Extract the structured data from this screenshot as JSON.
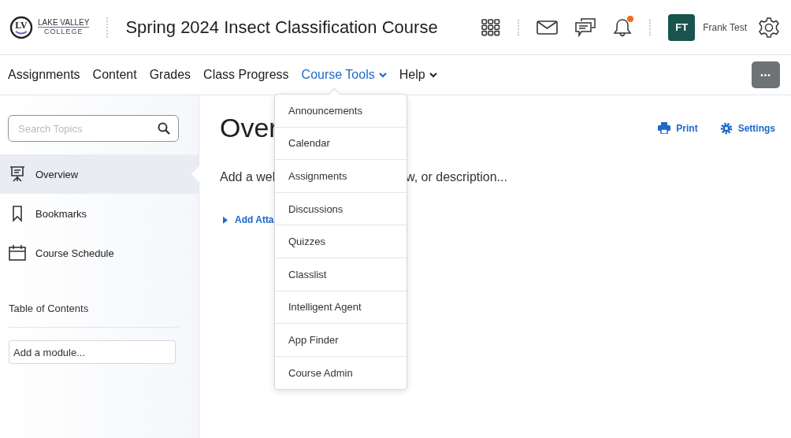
{
  "header": {
    "logo": {
      "line1": "LAKE VALLEY",
      "line2": "COLLEGE",
      "initials": "LV"
    },
    "course_title": "Spring 2024 Insect Classification Course",
    "notifications_unread": true,
    "user": {
      "initials": "FT",
      "name": "Frank Test"
    }
  },
  "nav": {
    "items": [
      {
        "label": "Assignments",
        "menu": false,
        "expanded": false
      },
      {
        "label": "Content",
        "menu": false,
        "expanded": false
      },
      {
        "label": "Grades",
        "menu": false,
        "expanded": false
      },
      {
        "label": "Class Progress",
        "menu": false,
        "expanded": false
      },
      {
        "label": "Course Tools",
        "menu": true,
        "expanded": true
      },
      {
        "label": "Help",
        "menu": true,
        "expanded": false
      }
    ],
    "more_button": "•••"
  },
  "dropdown": {
    "items": [
      "Announcements",
      "Calendar",
      "Assignments",
      "Discussions",
      "Quizzes",
      "Classlist",
      "Intelligent Agent",
      "App Finder",
      "Course Admin"
    ]
  },
  "sidebar": {
    "search": {
      "placeholder": "Search Topics"
    },
    "items": [
      {
        "kind": "overview",
        "label": "Overview",
        "selected": true
      },
      {
        "kind": "bookmarks",
        "label": "Bookmarks",
        "selected": false
      },
      {
        "kind": "schedule",
        "label": "Course Schedule",
        "selected": false
      }
    ],
    "toc_heading": "Table of Contents",
    "module_field": {
      "placeholder": "Add a module..."
    }
  },
  "content": {
    "title": "Over",
    "description_start": "Add a wel",
    "description_end": "w, or description...",
    "attach_link": "Add Atta",
    "actions": [
      {
        "kind": "print",
        "label": "Print"
      },
      {
        "kind": "settings",
        "label": "Settings"
      }
    ]
  }
}
